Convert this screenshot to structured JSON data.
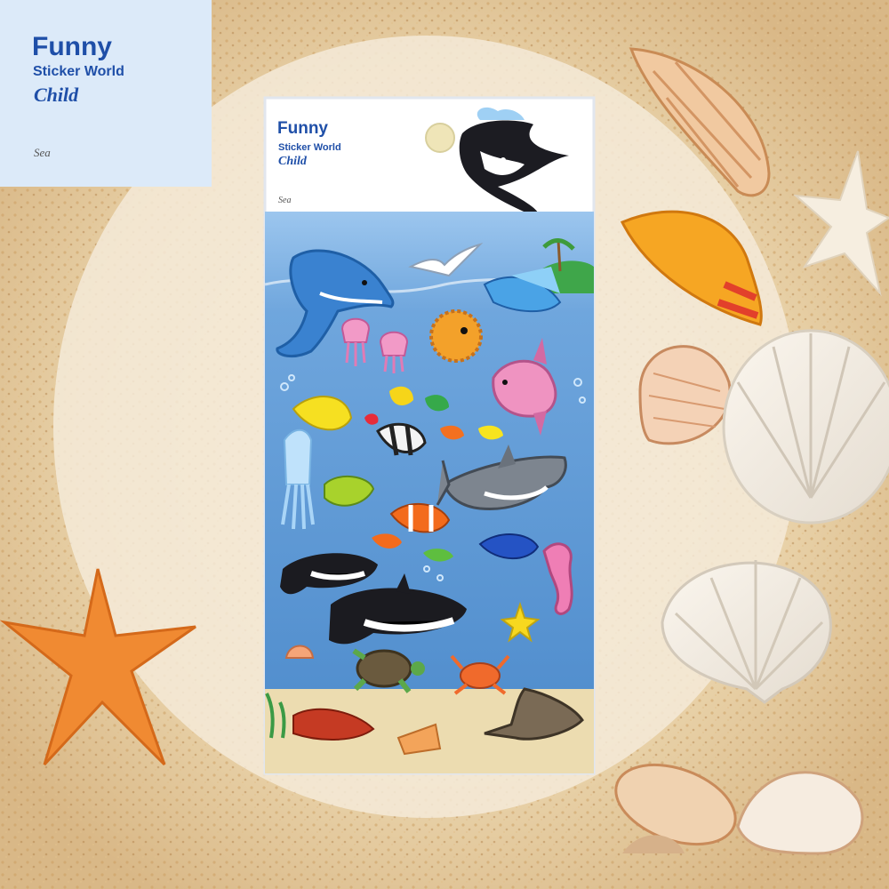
{
  "brand": {
    "line1": "Funny",
    "line2": "Sticker World",
    "line3": "Child",
    "theme": "Sea"
  },
  "package": {
    "line1": "Funny",
    "line2": "Sticker World",
    "line3": "Child",
    "theme": "Sea"
  },
  "colors": {
    "sand": "#e7d2a8",
    "card": "#dceaf9",
    "brand_blue": "#1f4fa8",
    "sea": "#6fa6dd"
  },
  "icons": [
    "fish-stick-figure-logo",
    "dolphin",
    "orca",
    "shark",
    "starfish",
    "seashell",
    "crab",
    "turtle",
    "seahorse",
    "jellyfish",
    "pufferfish",
    "clownfish",
    "stingray",
    "seagull",
    "island"
  ]
}
